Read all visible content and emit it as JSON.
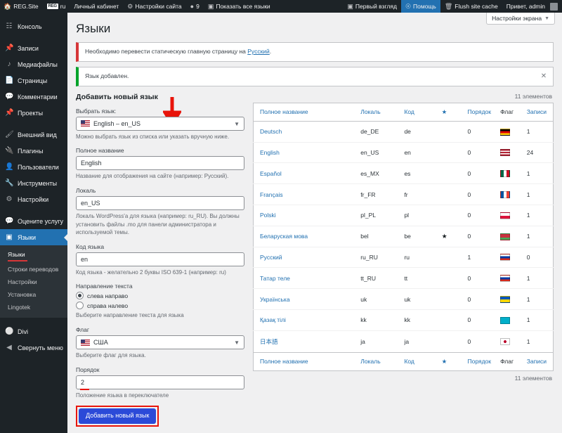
{
  "adminbar": {
    "left_items": [
      {
        "label": "REG.Site",
        "icon": "wordpress-home-icon"
      },
      {
        "label": "ru",
        "icon": "site-logo-badge",
        "badge": "REG"
      },
      {
        "label": "Личный кабинет",
        "icon": "dashboard-icon"
      },
      {
        "label": "Настройки сайта",
        "icon": "gear-icon"
      },
      {
        "label": "9",
        "icon": "comment-bubble-icon"
      },
      {
        "label": "Показать все языки",
        "icon": "translate-icon"
      }
    ],
    "right_items": [
      {
        "label": "Первый взгляд",
        "icon": "screen-icon"
      },
      {
        "label": "Помощь",
        "icon": "question-mark-icon",
        "highlight": true
      },
      {
        "label": "Flush site cache",
        "icon": "trash-icon"
      },
      {
        "label": "Привет, admin",
        "icon": "avatar"
      }
    ]
  },
  "sidebar": {
    "items": [
      {
        "label": "Консоль",
        "icon": "dashboard-icon",
        "gap_after": true
      },
      {
        "label": "Записи",
        "icon": "pin-icon"
      },
      {
        "label": "Медиафайлы",
        "icon": "media-icon"
      },
      {
        "label": "Страницы",
        "icon": "page-icon"
      },
      {
        "label": "Комментарии",
        "icon": "comment-icon"
      },
      {
        "label": "Проекты",
        "icon": "portfolio-icon",
        "gap_after": true
      },
      {
        "label": "Внешний вид",
        "icon": "appearance-brush-icon"
      },
      {
        "label": "Плагины",
        "icon": "plugin-icon"
      },
      {
        "label": "Пользователи",
        "icon": "users-icon"
      },
      {
        "label": "Инструменты",
        "icon": "tools-wrench-icon"
      },
      {
        "label": "Настройки",
        "icon": "settings-sliders-icon",
        "gap_after": true
      },
      {
        "label": "Оцените услугу",
        "icon": "comment-icon"
      },
      {
        "label": "Языки",
        "icon": "translate-icon",
        "current": true
      }
    ],
    "submenu": [
      {
        "label": "Языки",
        "current": true
      },
      {
        "label": "Строки переводов"
      },
      {
        "label": "Настройки"
      },
      {
        "label": "Установка"
      },
      {
        "label": "Lingotek"
      }
    ],
    "footer_items": [
      {
        "label": "Divi",
        "icon": "divi-logo-icon"
      },
      {
        "label": "Свернуть меню",
        "icon": "collapse-arrow-icon"
      }
    ]
  },
  "screen_options": {
    "label": "Настройки экрана"
  },
  "page": {
    "title": "Языки"
  },
  "notices": [
    {
      "type": "error",
      "text_before": "Необходимо перевести статическую главную страницу на ",
      "link": "Русский",
      "text_after": ".",
      "dismissible": false
    },
    {
      "type": "success",
      "text_before": "Язык добавлен.",
      "link": "",
      "text_after": "",
      "dismissible": true
    }
  ],
  "form": {
    "title": "Добавить новый язык",
    "select_language": {
      "label": "Выбрать язык:",
      "value": "English – en_US",
      "flag": "us",
      "help": "Можно выбрать язык из списка или указать вручную ниже."
    },
    "full_name": {
      "label": "Полное название",
      "value": "English",
      "help": "Название для отображения на сайте (например: Русский)."
    },
    "locale": {
      "label": "Локаль",
      "value": "en_US",
      "help": "Локаль WordPress'a для языка (например: ru_RU). Вы должны установить файлы .mo для панели администратора и используемой темы."
    },
    "lang_code": {
      "label": "Код языка",
      "value": "en",
      "help": "Код языка - желательно 2 буквы ISO 639-1 (например: ru)"
    },
    "text_direction": {
      "label": "Направление текста",
      "options": [
        {
          "label": "слева направо",
          "selected": true
        },
        {
          "label": "справа налево",
          "selected": false
        }
      ],
      "help": "Выберите направление текста для языка"
    },
    "flag": {
      "label": "Флаг",
      "value": "США",
      "flag": "us",
      "help": "Выберите флаг для языка."
    },
    "order": {
      "label": "Порядок",
      "value": "2",
      "help": "Положение языка в переключателе"
    },
    "submit_label": "Добавить новый язык"
  },
  "table": {
    "count_top": "11 элементов",
    "count_bottom": "11 элементов",
    "columns": [
      {
        "key": "name",
        "label": "Полное название"
      },
      {
        "key": "locale",
        "label": "Локаль"
      },
      {
        "key": "code",
        "label": "Код"
      },
      {
        "key": "star",
        "label": "★"
      },
      {
        "key": "order",
        "label": "Порядок"
      },
      {
        "key": "flag",
        "label": "Флаг"
      },
      {
        "key": "posts",
        "label": "Записи"
      }
    ],
    "rows": [
      {
        "name": "Deutsch",
        "locale": "de_DE",
        "code": "de",
        "star": false,
        "order": "0",
        "flag": "de",
        "posts": "1"
      },
      {
        "name": "English",
        "locale": "en_US",
        "code": "en",
        "star": false,
        "order": "0",
        "flag": "us",
        "posts": "24"
      },
      {
        "name": "Español",
        "locale": "es_MX",
        "code": "es",
        "star": false,
        "order": "0",
        "flag": "mx",
        "posts": "1"
      },
      {
        "name": "Français",
        "locale": "fr_FR",
        "code": "fr",
        "star": false,
        "order": "0",
        "flag": "fr",
        "posts": "1"
      },
      {
        "name": "Polski",
        "locale": "pl_PL",
        "code": "pl",
        "star": false,
        "order": "0",
        "flag": "pl",
        "posts": "1"
      },
      {
        "name": "Беларуская мова",
        "locale": "bel",
        "code": "be",
        "star": true,
        "order": "0",
        "flag": "by",
        "posts": "1"
      },
      {
        "name": "Русский",
        "locale": "ru_RU",
        "code": "ru",
        "star": false,
        "order": "1",
        "flag": "ru",
        "posts": "0"
      },
      {
        "name": "Татар теле",
        "locale": "tt_RU",
        "code": "tt",
        "star": false,
        "order": "0",
        "flag": "ru",
        "posts": "1"
      },
      {
        "name": "Українська",
        "locale": "uk",
        "code": "uk",
        "star": false,
        "order": "0",
        "flag": "ua",
        "posts": "1"
      },
      {
        "name": "Қазақ тілі",
        "locale": "kk",
        "code": "kk",
        "star": false,
        "order": "0",
        "flag": "kz",
        "posts": "1"
      },
      {
        "name": "日本語",
        "locale": "ja",
        "code": "ja",
        "star": false,
        "order": "0",
        "flag": "jp",
        "posts": "1"
      }
    ]
  },
  "colors": {
    "admin_dark": "#1d2327",
    "accent_blue": "#2271b1",
    "link_blue": "#2271b1",
    "button_blue": "#2b4ad8",
    "notice_error": "#d63638",
    "notice_success": "#00a32a",
    "annotation_red": "#e8140a",
    "page_bg": "#f0f0f1"
  }
}
